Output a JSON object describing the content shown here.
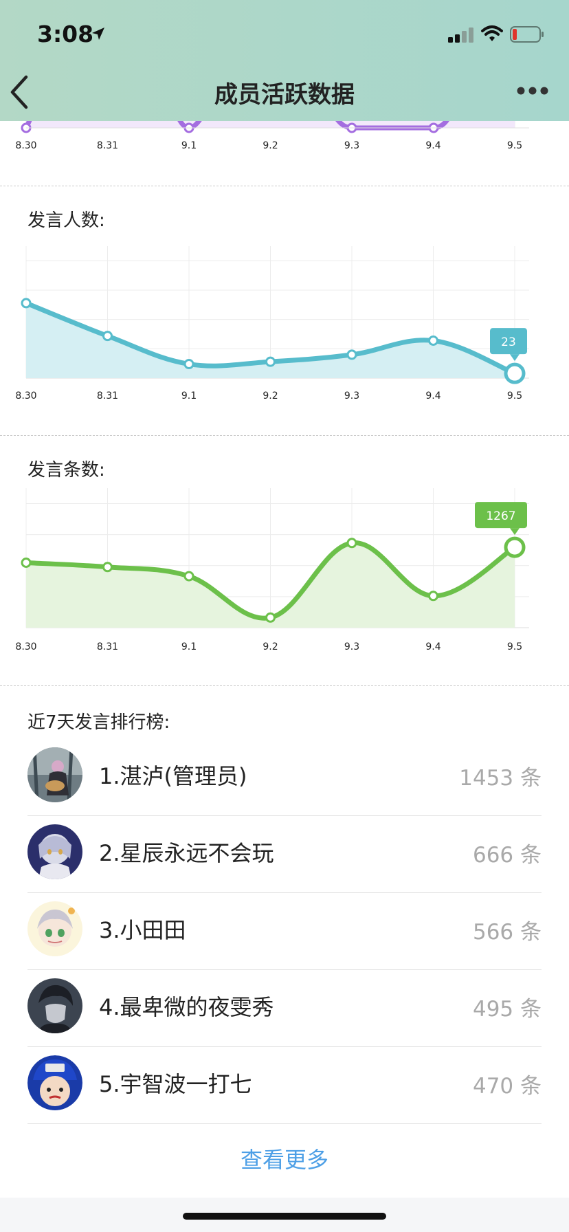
{
  "status_bar": {
    "time": "3:08"
  },
  "nav": {
    "title": "成员活跃数据"
  },
  "dates": [
    "8.30",
    "8.31",
    "9.1",
    "9.2",
    "9.3",
    "9.4",
    "9.5"
  ],
  "speaker_chart": {
    "title": "发言人数:",
    "tooltip": "23"
  },
  "message_chart": {
    "title": "发言条数:",
    "tooltip": "1267"
  },
  "chart_data": [
    {
      "type": "line",
      "title": "发言人数:",
      "categories": [
        "8.30",
        "8.31",
        "9.1",
        "9.2",
        "9.3",
        "9.4",
        "9.5"
      ],
      "series": [
        {
          "values": [
            38,
            31,
            25,
            25.5,
            27,
            30,
            23
          ]
        }
      ],
      "ylim": [
        22,
        44
      ],
      "grid": true,
      "color": "#57bccc",
      "fill": "#d5eff3"
    },
    {
      "type": "line",
      "title": "发言条数:",
      "categories": [
        "8.30",
        "8.31",
        "9.1",
        "9.2",
        "9.3",
        "9.4",
        "9.5"
      ],
      "series": [
        {
          "values": [
            1235,
            1226,
            1207,
            1121,
            1276,
            1166,
            1267
          ]
        }
      ],
      "ylim": [
        1100,
        1330
      ],
      "grid": true,
      "color": "#6cc04a",
      "fill": "#e6f4de"
    }
  ],
  "ranking": {
    "title": "近7天发言排行榜:",
    "unit": "条",
    "items": [
      {
        "name": "1.湛泸(管理员)",
        "count": "1453"
      },
      {
        "name": "2.星辰永远不会玩",
        "count": "666"
      },
      {
        "name": "3.小田田",
        "count": "566"
      },
      {
        "name": "4.最卑微的夜雯秀",
        "count": "495"
      },
      {
        "name": "5.宇智波一打七",
        "count": "470"
      }
    ],
    "see_more": "查看更多"
  },
  "colors": {
    "header_bg": "#a9d7c9",
    "link": "#4d9fe6",
    "chart1": "#57bccc",
    "chart2": "#6cc04a",
    "top_chart": "#a46de0"
  }
}
